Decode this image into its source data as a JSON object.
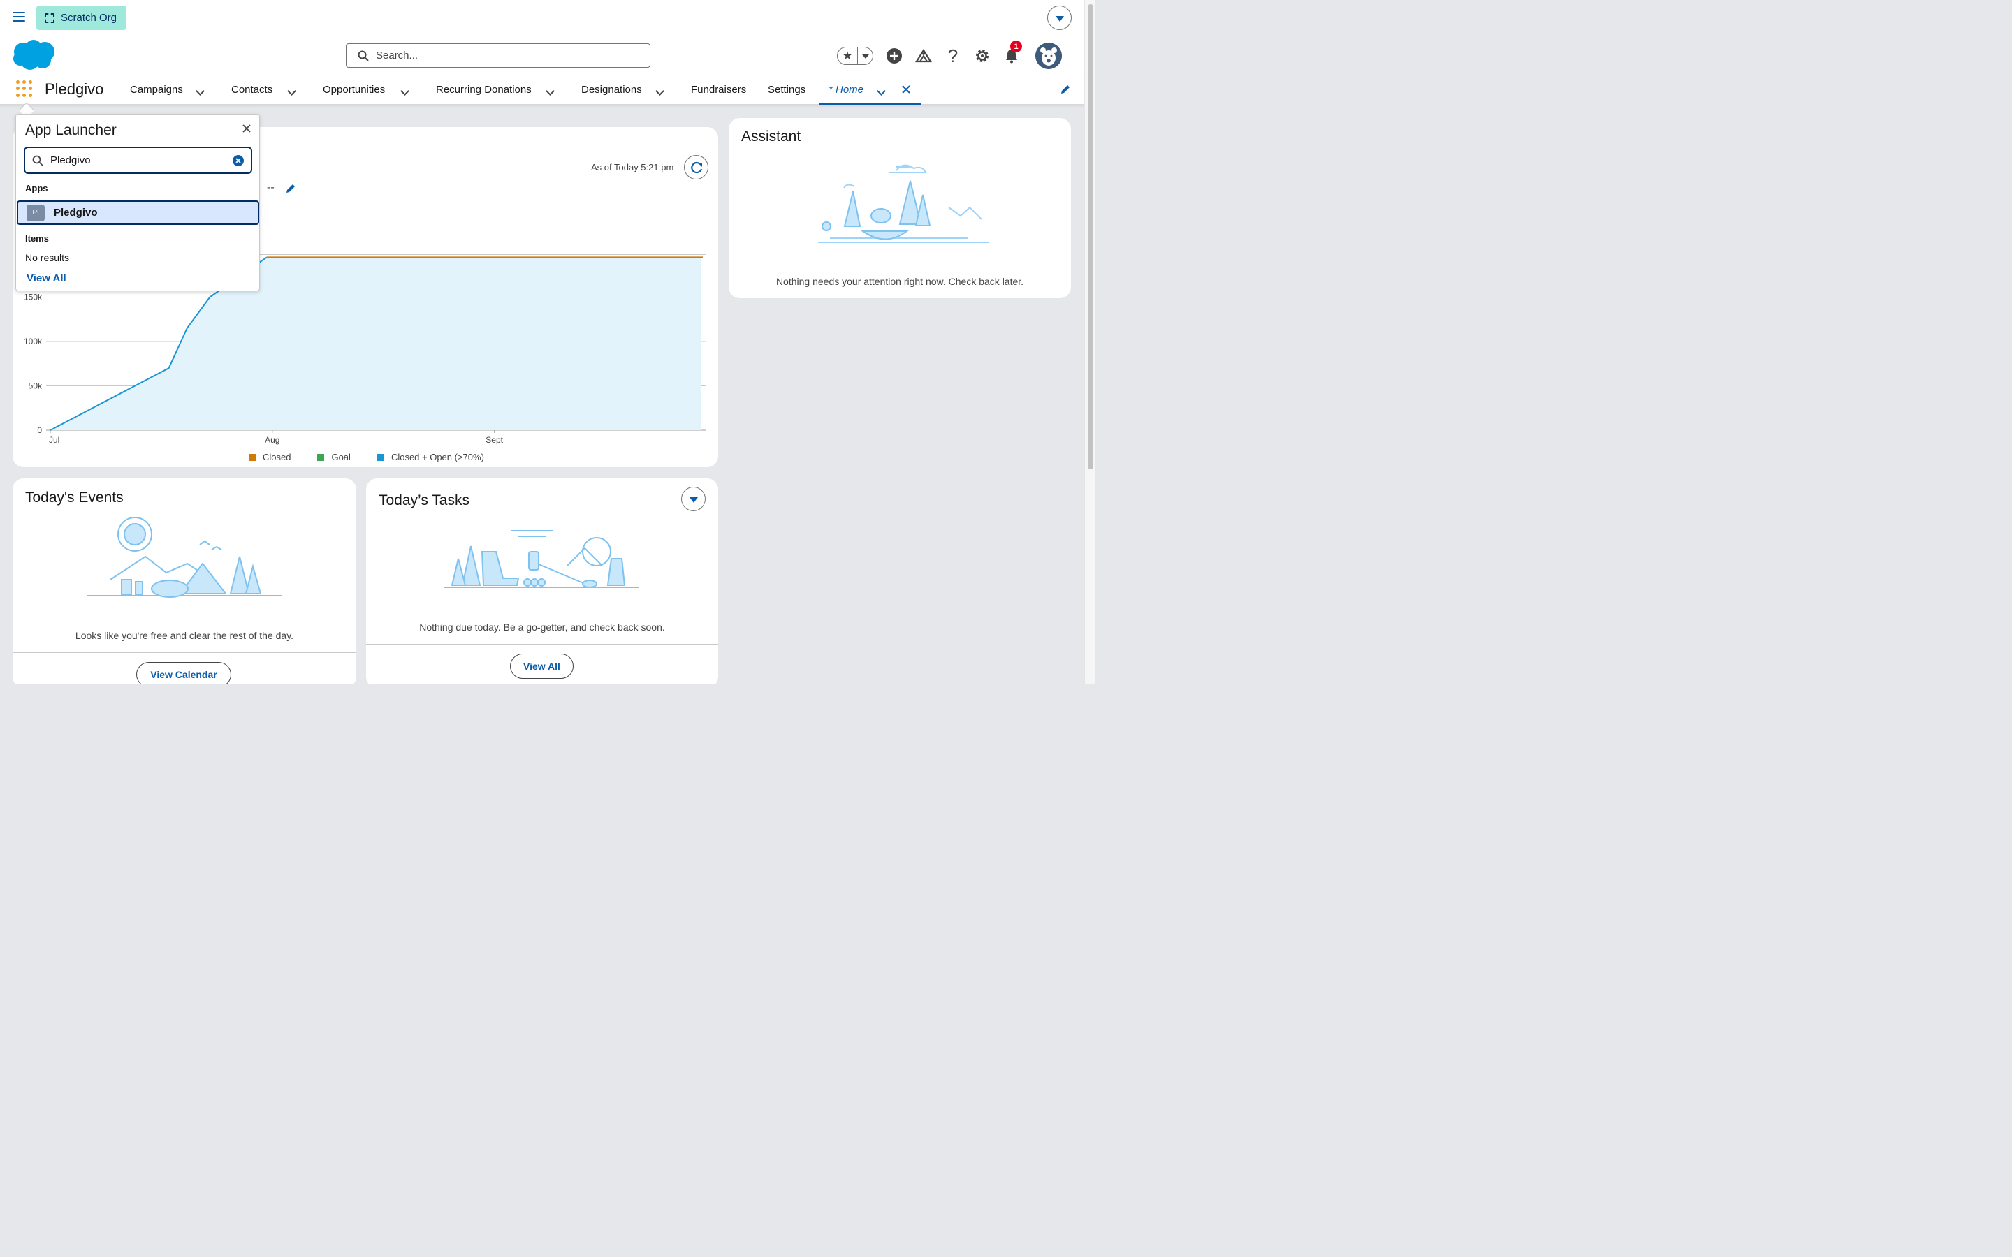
{
  "topbar": {
    "org_label": "Scratch Org"
  },
  "header": {
    "search_placeholder": "Search...",
    "notification_count": "1"
  },
  "nav": {
    "app_name": "Pledgivo",
    "items": [
      {
        "label": "Campaigns"
      },
      {
        "label": "Contacts"
      },
      {
        "label": "Opportunities"
      },
      {
        "label": "Recurring Donations"
      },
      {
        "label": "Designations"
      },
      {
        "label": "Fundraisers"
      },
      {
        "label": "Settings"
      }
    ],
    "active_tab": "* Home"
  },
  "chart_card": {
    "as_of": "As of Today 5:21 pm",
    "dashes": "--"
  },
  "chart_data": {
    "type": "line",
    "x": [
      "Jul",
      "Aug",
      "Sept"
    ],
    "y_ticks": [
      "0",
      "50k",
      "100k",
      "150k"
    ],
    "ylim": [
      0,
      200000
    ],
    "series": [
      {
        "name": "Closed",
        "color": "#d07a08",
        "values": [
          195000,
          195000
        ]
      },
      {
        "name": "Goal",
        "color": "#3ba755",
        "values": []
      },
      {
        "name": "Closed + Open (>70%)",
        "color": "#1b96d5",
        "points": [
          [
            0,
            0
          ],
          [
            0.52,
            70000
          ],
          [
            0.6,
            115000
          ],
          [
            0.7,
            150000
          ],
          [
            0.95,
            195000
          ]
        ]
      }
    ],
    "legend": [
      "Closed",
      "Goal",
      "Closed + Open (>70%)"
    ],
    "legend_position": "bottom"
  },
  "assistant": {
    "title": "Assistant",
    "message": "Nothing needs your attention right now. Check back later."
  },
  "events": {
    "title": "Today's Events",
    "message": "Looks like you're free and clear the rest of the day.",
    "button": "View Calendar"
  },
  "tasks": {
    "title": "Today’s Tasks",
    "message": "Nothing due today. Be a go-getter, and check back soon.",
    "button": "View All"
  },
  "launcher": {
    "title": "App Launcher",
    "search_value": "Pledgivo",
    "apps_label": "Apps",
    "app_tile": "Pl",
    "app_name": "Pledgivo",
    "items_label": "Items",
    "no_results": "No results",
    "view_all": "View All"
  },
  "colors": {
    "brand": "#0b5cab",
    "org_badge": "#9ee8dc",
    "notification": "#ea001e"
  }
}
